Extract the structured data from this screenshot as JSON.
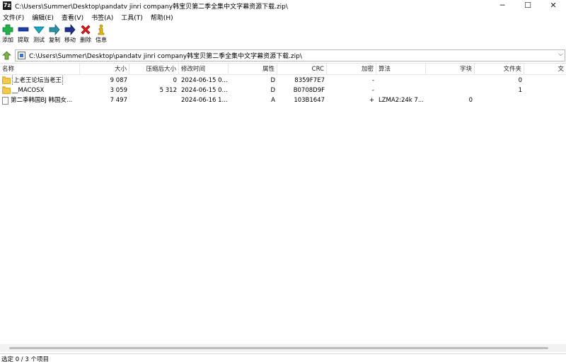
{
  "window": {
    "app_icon_text": "7z",
    "title": "C:\\Users\\Summer\\Desktop\\pandatv jinri company韩宝贝第二季全集中文字幕资源下载.zip\\",
    "minimize": "─",
    "maximize": "☐",
    "close": "✕"
  },
  "menu": [
    "文件(F)",
    "编辑(E)",
    "查看(V)",
    "书签(A)",
    "工具(T)",
    "帮助(H)"
  ],
  "toolbar": {
    "add": "添加",
    "extract": "提取",
    "test": "测试",
    "copy": "复制",
    "move": "移动",
    "delete": "删除",
    "info": "信息",
    "colors": {
      "add": "#22b14c",
      "extract": "#1e3faa",
      "test": "#1aa8c4",
      "copy": "#2c8fa4",
      "move": "#1e2f8c",
      "delete": "#d81e1e",
      "info": "#e6b800"
    }
  },
  "address": {
    "path": "C:\\Users\\Summer\\Desktop\\pandatv jinri company韩宝贝第二季全集中文字幕资源下载.zip\\"
  },
  "columns": {
    "name": "名称",
    "size": "大小",
    "packed": "压缩后大小",
    "modified": "修改时间",
    "attr": "属性",
    "crc": "CRC",
    "encrypted": "加密",
    "method": "算法",
    "block": "字块",
    "folders": "文件夹",
    "files": "文"
  },
  "rows": [
    {
      "name": "上老王论坛当老王",
      "size": "9 087",
      "packed": "0",
      "modified": "2024-06-15 0...",
      "attr": "D",
      "crc": "8359F7E7",
      "encrypted": "-",
      "method": "",
      "block": "",
      "folders": "0",
      "type": "folder"
    },
    {
      "name": "__MACOSX",
      "size": "3 059",
      "packed": "5 312",
      "modified": "2024-06-15 0...",
      "attr": "D",
      "crc": "B0708D9F",
      "encrypted": "-",
      "method": "",
      "block": "",
      "folders": "1",
      "type": "folder"
    },
    {
      "name": "第二季韩国BJ  韩国女...",
      "size": "7 497",
      "packed": "",
      "modified": "2024-06-16 1...",
      "attr": "A",
      "crc": "103B1647",
      "encrypted": "+",
      "method": "LZMA2:24k 7...",
      "block": "0",
      "folders": "",
      "type": "file"
    }
  ],
  "status": {
    "text": "选定 0 / 3 个项目"
  }
}
